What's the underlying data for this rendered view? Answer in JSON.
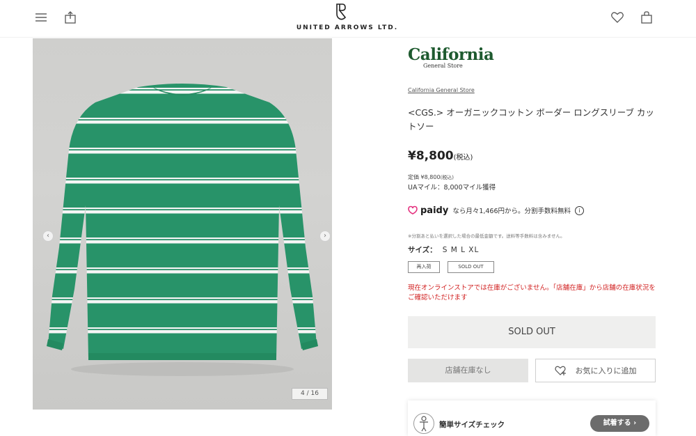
{
  "header": {
    "menu_icon": "hamburger-menu-icon",
    "share_icon": "share-icon",
    "logo_text": "UNITED ARROWS LTD.",
    "favorite_icon": "heart-icon",
    "bag_icon": "shopping-bag-icon"
  },
  "gallery": {
    "prev_arrow": "‹",
    "next_arrow": "›",
    "counter": "4 / 16",
    "shirt_color": "#2a9a6e",
    "stripe_color": "#ffffff"
  },
  "product": {
    "brand_logo_main": "California",
    "brand_logo_sub": "General Store",
    "brand_link": "California General Store",
    "title": "<CGS.> オーガニックコットン ボーダー ロングスリーブ カットソー",
    "price": "¥8,800",
    "price_tax": "(税込)",
    "regular_price": "定価 ¥8,800",
    "regular_tax": "(税込)",
    "miles": "UAマイル：8,000マイル獲得",
    "paidy_brand": "paidy",
    "paidy_text": "なら月々1,466円から。分割手数料無料",
    "paidy_info": "i",
    "note": "※分割あと払いを選択した場合の最低金額です。送料等手数料は含みません。",
    "size_label": "サイズ：",
    "sizes": "S M L XL",
    "badge_restock": "再入荷",
    "badge_soldout": "SOLD OUT",
    "stock_message": "現在オンラインストアでは在庫がございません。「店舗在庫」から店舗の在庫状況をご確認いただけます",
    "soldout_button": "SOLD OUT",
    "store_button": "店舗在庫なし",
    "favorite_button": "お気に入りに追加",
    "size_check_label": "簡単サイズチェック",
    "size_check_button": "試着する ›"
  },
  "colors": {
    "brand_green": "#1e5a2f",
    "alert_red": "#d11f1f",
    "paidy_pink": "#e4307e"
  }
}
